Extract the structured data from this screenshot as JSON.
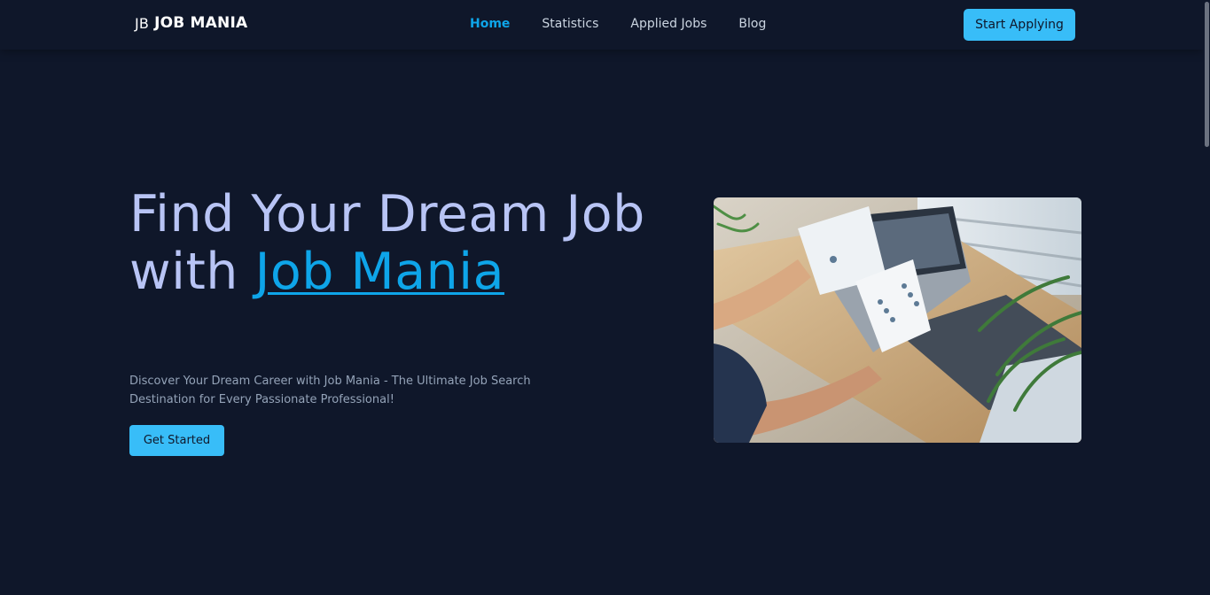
{
  "nav": {
    "logo_mark": "JB",
    "logo_text": "JOB MANIA",
    "links": [
      {
        "label": "Home",
        "active": true
      },
      {
        "label": "Statistics",
        "active": false
      },
      {
        "label": "Applied Jobs",
        "active": false
      },
      {
        "label": "Blog",
        "active": false
      }
    ],
    "cta_label": "Start Applying"
  },
  "hero": {
    "title_part1": "Find Your Dream Job with ",
    "title_highlight": "Job Mania",
    "subtitle": "Discover Your Dream Career with Job Mania - The Ultimate Job Search Destination for Every Passionate Professional!",
    "cta_label": "Get Started"
  },
  "colors": {
    "background": "#0f172a",
    "accent": "#38bdf8",
    "highlight": "#0ea5e9",
    "title": "#b8c4f5",
    "muted": "#94a3b8"
  }
}
